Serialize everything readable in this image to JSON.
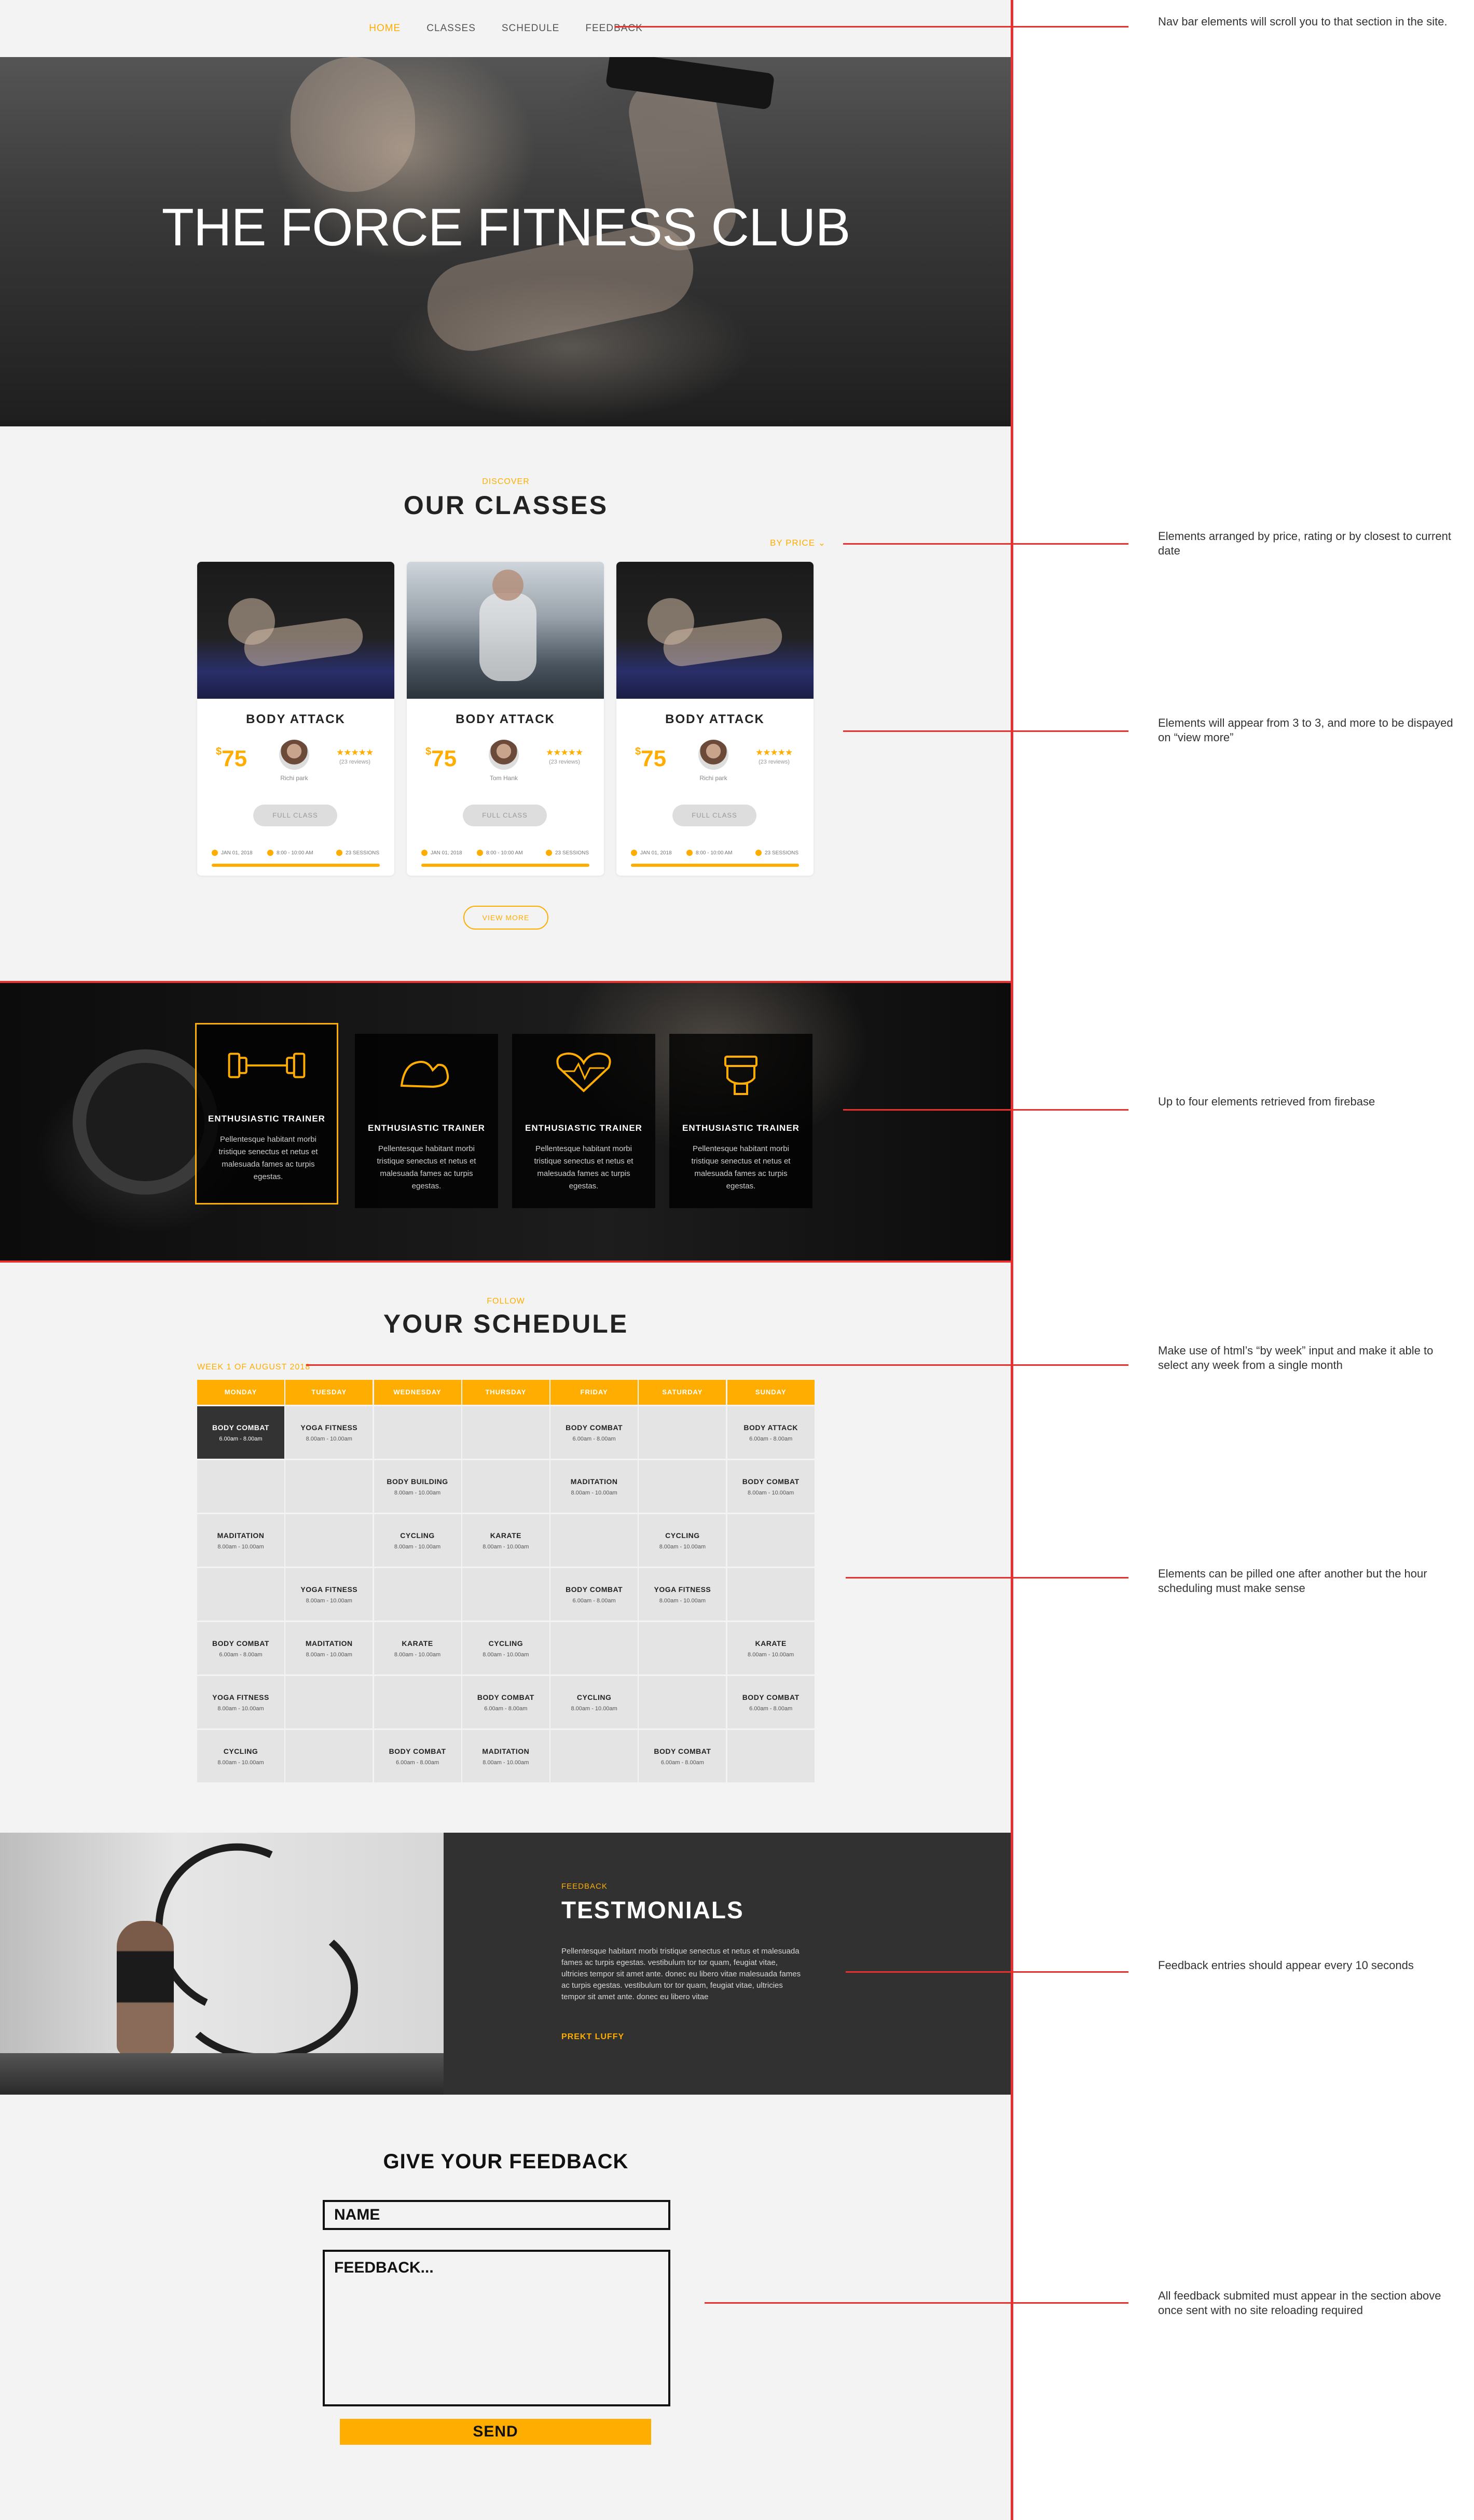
{
  "nav": {
    "items": [
      {
        "label": "HOME"
      },
      {
        "label": "CLASSES"
      },
      {
        "label": "SCHEDULE"
      },
      {
        "label": "FEEDBACK"
      }
    ]
  },
  "hero": {
    "title": "THE FORCE FITNESS CLUB"
  },
  "classes": {
    "eyebrow": "DISCOVER",
    "title": "OUR CLASSES",
    "sort_label": "BY PRICE ⌄",
    "view_more": "VIEW MORE",
    "cards": [
      {
        "title": "BODY ATTACK",
        "currency": "$",
        "price": "75",
        "trainer": "Richi park",
        "stars": "★★★★★",
        "reviews": "(23 reviews)",
        "button": "FULL CLASS",
        "date": "JAN 01, 2018",
        "time": "8:00 - 10:00 AM",
        "sessions": "23 SESSIONS"
      },
      {
        "title": "BODY ATTACK",
        "currency": "$",
        "price": "75",
        "trainer": "Tom Hank",
        "stars": "★★★★★",
        "reviews": "(23 reviews)",
        "button": "FULL CLASS",
        "date": "JAN 01, 2018",
        "time": "8:00 - 10:00 AM",
        "sessions": "23 SESSIONS"
      },
      {
        "title": "BODY ATTACK",
        "currency": "$",
        "price": "75",
        "trainer": "Richi park",
        "stars": "★★★★★",
        "reviews": "(23 reviews)",
        "button": "FULL CLASS",
        "date": "JAN 01, 2018",
        "time": "8:00 - 10:00 AM",
        "sessions": "23 SESSIONS"
      }
    ]
  },
  "trainers": [
    {
      "name": "ENTHUSIASTIC TRAINER",
      "desc": "Pellentesque habitant morbi tristique senectus et netus et malesuada fames ac turpis egestas.",
      "icon": "dumbbell-icon"
    },
    {
      "name": "ENTHUSIASTIC TRAINER",
      "desc": "Pellentesque habitant morbi tristique senectus et netus et malesuada fames ac turpis egestas.",
      "icon": "flexed-arm-icon"
    },
    {
      "name": "ENTHUSIASTIC TRAINER",
      "desc": "Pellentesque habitant morbi tristique senectus et netus et malesuada fames ac turpis egestas.",
      "icon": "heartbeat-icon"
    },
    {
      "name": "ENTHUSIASTIC TRAINER",
      "desc": "Pellentesque habitant morbi tristique senectus et netus et malesuada fames ac turpis egestas.",
      "icon": "fist-icon"
    }
  ],
  "schedule": {
    "eyebrow": "FOLLOW",
    "title": "YOUR SCHEDULE",
    "week_label": "WEEK 1 OF AUGUST 2018",
    "days": [
      "MONDAY",
      "TUESDAY",
      "WEDNESDAY",
      "THURSDAY",
      "FRIDAY",
      "SATURDAY",
      "SUNDAY"
    ],
    "rows": [
      [
        {
          "name": "BODY COMBAT",
          "time": "6.00am - 8.00am",
          "active": true
        },
        {
          "name": "YOGA FITNESS",
          "time": "8.00am - 10.00am"
        },
        {},
        {},
        {
          "name": "BODY COMBAT",
          "time": "6.00am - 8.00am"
        },
        {},
        {
          "name": "BODY ATTACK",
          "time": "6.00am - 8.00am"
        }
      ],
      [
        {},
        {},
        {
          "name": "BODY BUILDING",
          "time": "8.00am - 10.00am"
        },
        {},
        {
          "name": "MADITATION",
          "time": "8.00am - 10.00am"
        },
        {},
        {
          "name": "BODY COMBAT",
          "time": "8.00am - 10.00am"
        }
      ],
      [
        {
          "name": "MADITATION",
          "time": "8.00am - 10.00am"
        },
        {},
        {
          "name": "CYCLING",
          "time": "8.00am - 10.00am"
        },
        {
          "name": "KARATE",
          "time": "8.00am - 10.00am"
        },
        {},
        {
          "name": "CYCLING",
          "time": "8.00am - 10.00am"
        },
        {}
      ],
      [
        {},
        {
          "name": "YOGA FITNESS",
          "time": "8.00am - 10.00am"
        },
        {},
        {},
        {
          "name": "BODY COMBAT",
          "time": "6.00am - 8.00am"
        },
        {
          "name": "YOGA FITNESS",
          "time": "8.00am - 10.00am"
        },
        {}
      ],
      [
        {
          "name": "BODY COMBAT",
          "time": "6.00am - 8.00am"
        },
        {
          "name": "MADITATION",
          "time": "8.00am - 10.00am"
        },
        {
          "name": "KARATE",
          "time": "8.00am - 10.00am"
        },
        {
          "name": "CYCLING",
          "time": "8.00am - 10.00am"
        },
        {},
        {},
        {
          "name": "KARATE",
          "time": "8.00am - 10.00am"
        }
      ],
      [
        {
          "name": "YOGA FITNESS",
          "time": "8.00am - 10.00am"
        },
        {},
        {},
        {
          "name": "BODY COMBAT",
          "time": "6.00am - 8.00am"
        },
        {
          "name": "CYCLING",
          "time": "8.00am - 10.00am"
        },
        {},
        {
          "name": "BODY COMBAT",
          "time": "6.00am - 8.00am"
        }
      ],
      [
        {
          "name": "CYCLING",
          "time": "8.00am - 10.00am"
        },
        {},
        {
          "name": "BODY COMBAT",
          "time": "6.00am - 8.00am"
        },
        {
          "name": "MADITATION",
          "time": "8.00am - 10.00am"
        },
        {},
        {
          "name": "BODY COMBAT",
          "time": "6.00am - 8.00am"
        },
        {}
      ]
    ]
  },
  "testimonials": {
    "label": "FEEDBACK",
    "title": "TESTMONIALS",
    "text": "Pellentesque habitant morbi tristique senectus et netus et malesuada fames ac turpis egestas. vestibulum tor tor quam, feugiat vitae, ultricies tempor sit amet ante. donec eu libero vitae malesuada fames ac turpis egestas. vestibulum tor tor quam, feugiat vitae, ultricies tempor sit amet ante. donec eu libero vitae",
    "author": "PREKT LUFFY"
  },
  "feedback": {
    "title": "GIVE YOUR FEEDBACK",
    "name_placeholder": "NAME",
    "text_placeholder": "FEEDBACK...",
    "send": "SEND"
  },
  "annotations": [
    {
      "text": "Nav bar elements will scroll you to that section in the site."
    },
    {
      "text": "Elements arranged by price, rating or by closest to current date"
    },
    {
      "text": "Elements will appear from 3 to 3, and more to be dispayed on “view more”"
    },
    {
      "text": "Up to four elements retrieved from firebase"
    },
    {
      "text": "Make use of html’s “by week” input and make it able to select any week from a single month"
    },
    {
      "text": "Elements can be pilled one after another but the hour scheduling must make sense"
    },
    {
      "text": "Feedback entries should appear every 10 seconds"
    },
    {
      "text": "All feedback submited must appear in the section above once sent with no site reloading required"
    }
  ],
  "colors": {
    "accent": "#ffad00",
    "annotation_line": "#e8302f",
    "dark_panel": "#313131"
  }
}
